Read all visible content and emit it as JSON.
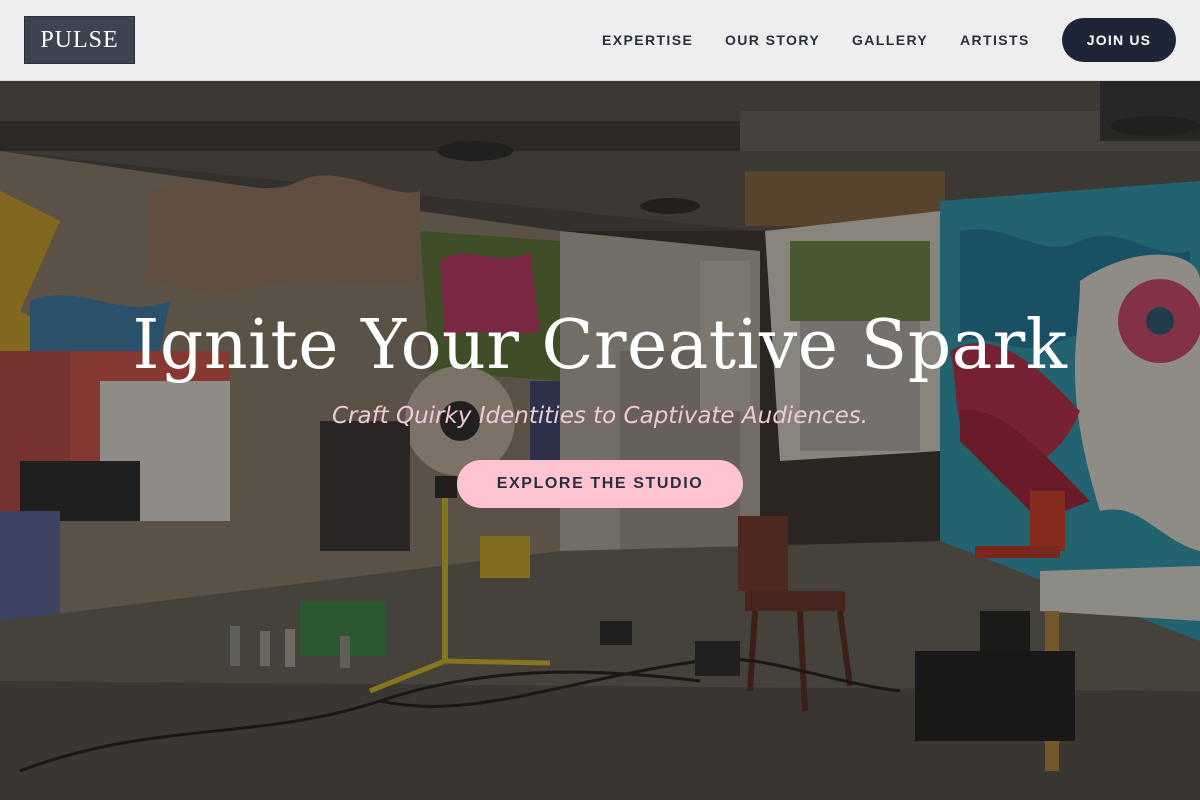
{
  "brand": {
    "logo_text": "PULSE"
  },
  "nav": {
    "items": [
      {
        "label": "EXPERTISE"
      },
      {
        "label": "OUR STORY"
      },
      {
        "label": "GALLERY"
      },
      {
        "label": "ARTISTS"
      }
    ],
    "cta_label": "JOIN US"
  },
  "hero": {
    "title": "Ignite Your Creative Spark",
    "subtitle": "Craft Quirky Identities to Captivate Audiences.",
    "cta_label": "EXPLORE THE STUDIO",
    "background_image": "graffiti-art-studio-photo"
  },
  "colors": {
    "header_bg": "#eeeeee",
    "logo_bg": "#3c4452",
    "nav_text": "#2a2f3a",
    "join_button_bg": "#1d2637",
    "cta_button_bg": "#ffc4d0",
    "subtitle_text": "#f1c8d8"
  }
}
